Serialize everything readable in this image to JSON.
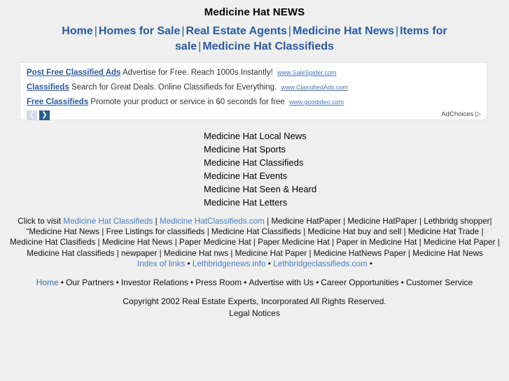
{
  "header": {
    "title": "Medicine Hat NEWS",
    "nav_items": [
      "Home",
      "Homes for Sale",
      "Real Estate Agents",
      "Medicine Hat News",
      "Items for sale",
      "Medicine Hat Classifieds"
    ],
    "separator": "|"
  },
  "ads": {
    "rows": [
      {
        "title": "Post Free Classified Ads",
        "desc": "Advertise for Free. Reach 1000s Instantly!",
        "url": "www.SaleSpider.com"
      },
      {
        "title": "Classifieds",
        "desc": "Search for Great Deals. Online Classifieds for Everything.",
        "url": "www.ClassifiedAds.com"
      },
      {
        "title": "Free Classifieds",
        "desc": "Promote your product or service in 60 seconds for free",
        "url": "www.goodideo.com"
      }
    ],
    "prev_label": "❮",
    "next_label": "❯",
    "adchoices_label": "AdChoices",
    "adchoices_glyph": "▷"
  },
  "link_list": {
    "items": [
      "Medicine Hat Local News",
      "Medicine Hat Sports",
      "Medicine Hat Classifieds",
      "Medicine Hat Events",
      "Medicine Hat Seen & Heard",
      "Medicine Hat Letters"
    ]
  },
  "keywords": {
    "lead_text": "Click to visit ",
    "link1": "Medicine Hat Classifieds",
    "link2": "Medicine HatClassifieds.com",
    "tail_text": " | Medicine HatPaper | Medicine HatPaper | Lethbridg shopper| “Medicine Hat News | Free Listings for classifieds | Medicine Hat Classifieds | Medicine Hat buy and sell | Medicine Hat Trade | Medicine Hat Clasifieds | Medicine Hat News | Paper Medicine Hat | Paper Medicine Hat | Paper in Medicine Hat | Medicine Hat Paper | Medicine Hat classifieds | newpaper | Medicine Hat nws | Medicine Hat Paper | Medicine HatNews Paper | Medicine Hat News",
    "index_links": [
      "Index of links",
      "Lethbridgenews.info",
      "Lethbridgeclassifieds.com"
    ],
    "index_separator": "•",
    "index_trailing": "•"
  },
  "bottom_nav": {
    "items": [
      "Home",
      "Our Partners",
      "Investor Relations",
      "Press Room",
      "Advertise with Us",
      "Career Opportunities",
      "Customer Service"
    ],
    "separator": "•"
  },
  "footer": {
    "copyright": "Copyright 2002 Real Estate Experts, Incorporated All Rights Reserved.",
    "legal": "Legal Notices"
  },
  "colors": {
    "page_bg": "#efefef",
    "nav_blue": "#2a5a9e",
    "link_blue": "#4a7fc1",
    "ad_title_blue": "#2c5aa0",
    "ad_next_btn": "#2c5d92",
    "ad_prev_btn": "#d3dce8"
  }
}
